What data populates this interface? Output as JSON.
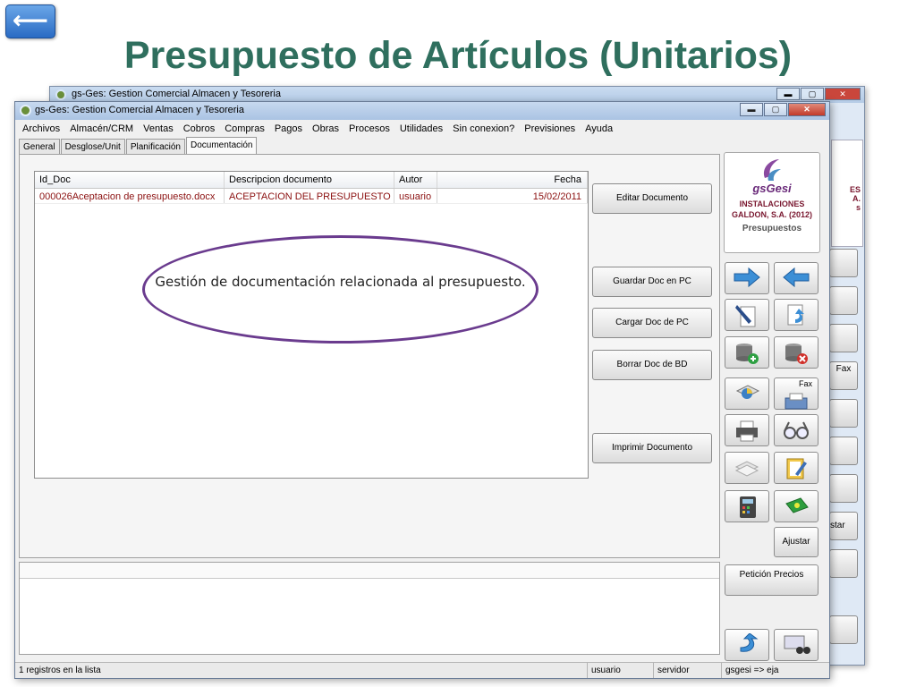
{
  "slide": {
    "title": "Presupuesto de Artículos (Unitarios)",
    "back_label": "⟵"
  },
  "bg_window": {
    "title": "gs-Ges: Gestion Comercial Almacen y Tesoreria",
    "peek_text": "ES\nA.\ns",
    "peek_fax": "Fax",
    "peek_ajustar": "star"
  },
  "window": {
    "title": "gs-Ges: Gestion Comercial Almacen y Tesoreria",
    "controls": {
      "minimize": "▬",
      "maximize": "▢",
      "close": "✕"
    }
  },
  "menu": [
    "Archivos",
    "Almacén/CRM",
    "Ventas",
    "Cobros",
    "Compras",
    "Pagos",
    "Obras",
    "Procesos",
    "Utilidades",
    "Sin conexion?",
    "Previsiones",
    "Ayuda"
  ],
  "tabs": [
    "General",
    "Desglose/Unit",
    "Planificación",
    "Documentación"
  ],
  "active_tab": "Documentación",
  "grid": {
    "columns": [
      "Id_Doc",
      "Descripcion documento",
      "Autor",
      "Fecha"
    ],
    "rows": [
      {
        "id": "000026Aceptacion de presupuesto.docx",
        "desc": "ACEPTACION DEL PRESUPUESTO",
        "autor": "usuario",
        "fecha": "15/02/2011"
      }
    ]
  },
  "callout": "Gestión de documentación relacionada al presupuesto.",
  "actions": {
    "edit": "Editar Documento",
    "save_pc": "Guardar Doc en PC",
    "load_pc": "Cargar Doc de PC",
    "delete_db": "Borrar Doc de BD",
    "print": "Imprimir Documento"
  },
  "logo": {
    "name": "gsGesi",
    "company": "INSTALACIONES GALDON, S.A. (2012)",
    "module": "Presupuestos"
  },
  "side": {
    "ajustar": "Ajustar",
    "peticion": "Petición Precios",
    "fax_label": "Fax"
  },
  "status": {
    "count": "1 registros en la lista",
    "user": "usuario",
    "server": "servidor",
    "db": "gsgesi => eja"
  },
  "colors": {
    "title": "#2f6f5e",
    "row_text": "#8b1010",
    "callout_border": "#6a3b8e",
    "logo": "#6a2a7a"
  }
}
